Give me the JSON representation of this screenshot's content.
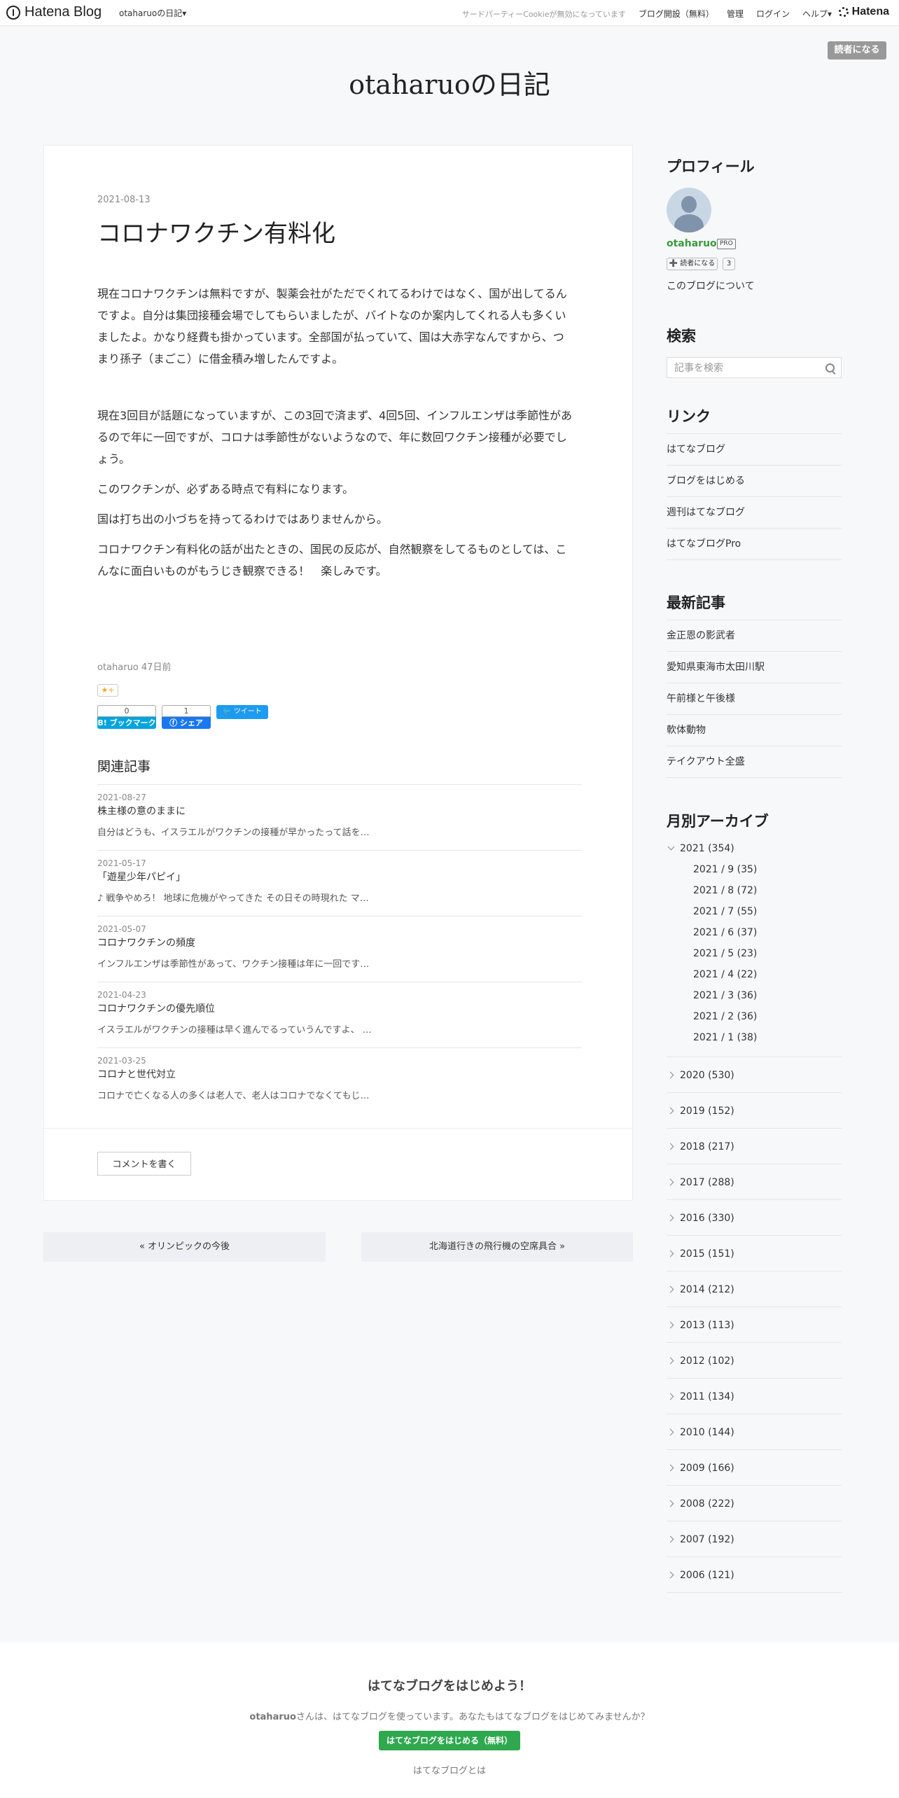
{
  "header": {
    "logo_text": "Hatena Blog",
    "blog_menu": "otaharuoの日記▾",
    "cookie_notice": "サードパーティーCookieが無効になっています",
    "start_blog": "ブログ開設（無料）",
    "manage": "管理",
    "login": "ログイン",
    "help": "ヘルプ▾",
    "hatena_logo": "Hatena"
  },
  "subscribe_top": "読者になる",
  "blog_title": "otaharuoの日記",
  "entry": {
    "date": "2021-08-13",
    "title": "コロナワクチン有料化",
    "paragraphs": [
      "現在コロナワクチンは無料ですが、製薬会社がただでくれてるわけではなく、国が出してるんですよ。自分は集団接種会場でしてもらいましたが、バイトなのか案内してくれる人も多くいましたよ。かなり経費も掛かっています。全部国が払っていて、国は大赤字なんですから、つまり孫子（まごこ）に借金積み増したんですよ。",
      "現在3回目が話題になっていますが、この3回で済まず、4回5回、インフルエンザは季節性があるので年に一回ですが、コロナは季節性がないようなので、年に数回ワクチン接種が必要でしょう。",
      "このワクチンが、必ずある時点で有料になります。",
      "国は打ち出の小づちを持ってるわけではありませんから。",
      "コロナワクチン有料化の話が出たときの、国民の反応が、自然観察をしてるものとしては、こんなに面白いものがもうじき観察できる！　楽しみです。"
    ],
    "author": "otaharuo",
    "ago": "47日前",
    "star_label": "★+",
    "hatebu_count": "0",
    "hatebu_label": "B! ブックマーク",
    "fb_count": "1",
    "fb_label": "ⓕ シェア",
    "tweet_label": "ツイート"
  },
  "related": {
    "title": "関連記事",
    "items": [
      {
        "date": "2021-08-27",
        "title": "株主様の意のままに",
        "snippet": "自分はどうも、イスラエルがワクチンの接種が早かったって話を…"
      },
      {
        "date": "2021-05-17",
        "title": "「遊星少年パピイ」",
        "snippet": "♪ 戦争やめろ！ 地球に危機がやってきた その日その時現れた マ…"
      },
      {
        "date": "2021-05-07",
        "title": "コロナワクチンの頻度",
        "snippet": "インフルエンザは季節性があって、ワクチン接種は年に一回です…"
      },
      {
        "date": "2021-04-23",
        "title": "コロナワクチンの優先順位",
        "snippet": "イスラエルがワクチンの接種は早く進んでるっていうんですよ、 …"
      },
      {
        "date": "2021-03-25",
        "title": "コロナと世代対立",
        "snippet": "コロナで亡くなる人の多くは老人で、老人はコロナでなくてもじ…"
      }
    ]
  },
  "comment_button": "コメントを書く",
  "pager": {
    "prev": "« オリンピックの今後",
    "next": "北海道行きの飛行機の空席具合 »"
  },
  "sidebar": {
    "profile": {
      "title": "プロフィール",
      "name": "otaharuo",
      "badge": "PRO",
      "subscribe": "➕ 読者になる",
      "subscribers": "3",
      "about": "このブログについて"
    },
    "search": {
      "title": "検索",
      "placeholder": "記事を検索"
    },
    "links": {
      "title": "リンク",
      "items": [
        "はてなブログ",
        "ブログをはじめる",
        "週刊はてなブログ",
        "はてなブログPro"
      ]
    },
    "recent": {
      "title": "最新記事",
      "items": [
        "金正恩の影武者",
        "愛知県東海市太田川駅",
        "午前様と午後様",
        "軟体動物",
        "テイクアウト全盛"
      ]
    },
    "archive": {
      "title": "月別アーカイブ",
      "open_year": "2021 (354)",
      "months": [
        "2021 / 9 (35)",
        "2021 / 8 (72)",
        "2021 / 7 (55)",
        "2021 / 6 (37)",
        "2021 / 5 (23)",
        "2021 / 4 (22)",
        "2021 / 3 (36)",
        "2021 / 2 (36)",
        "2021 / 1 (38)"
      ],
      "years": [
        "2020 (530)",
        "2019 (152)",
        "2018 (217)",
        "2017 (288)",
        "2016 (330)",
        "2015 (151)",
        "2014 (212)",
        "2013 (113)",
        "2012 (102)",
        "2011 (134)",
        "2010 (144)",
        "2009 (166)",
        "2008 (222)",
        "2007 (192)",
        "2006 (121)"
      ]
    }
  },
  "footer": {
    "title": "はてなブログをはじめよう！",
    "user": "otaharuo",
    "text": "さんは、はてなブログを使っています。あなたもはてなブログをはじめてみませんか？",
    "button": "はてなブログをはじめる（無料）",
    "about": "はてなブログとは"
  }
}
